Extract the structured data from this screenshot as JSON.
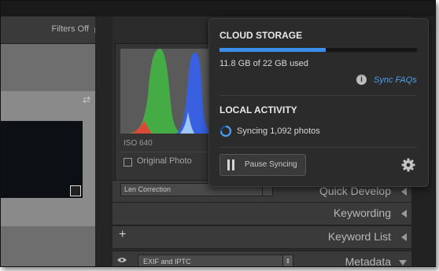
{
  "filter_bar": {
    "label": "Filters Off"
  },
  "histogram": {
    "iso": "ISO 640",
    "original_photo": "Original Photo"
  },
  "panels": {
    "quick_develop": "Quick Develop",
    "lens_preset": "Len Correction",
    "keywording": "Keywording",
    "keyword_list": "Keyword List",
    "metadata": "Metadata",
    "metadata_preset": "EXIF and IPTC"
  },
  "cloud_popup": {
    "storage_title": "CLOUD STORAGE",
    "used_text": "11.8 GB of 22 GB used",
    "used_fraction": 0.536,
    "faq_link": "Sync FAQs",
    "activity_title": "LOCAL ACTIVITY",
    "sync_status": "Syncing 1,092 photos",
    "pause_button": "Pause Syncing"
  },
  "colors": {
    "accent": "#3c8fe8",
    "link": "#4aa0ee"
  },
  "icons": [
    "lock-icon",
    "info-icon",
    "spinner-icon",
    "pause-icon",
    "gear-icon",
    "eye-icon",
    "plus-icon"
  ]
}
